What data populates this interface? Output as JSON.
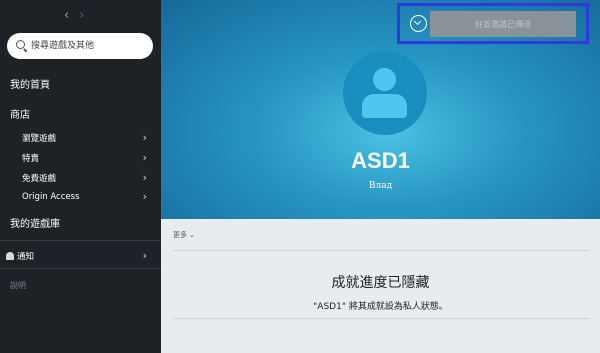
{
  "sidebar": {
    "nav_back": "‹",
    "nav_forward": "›",
    "search": {
      "placeholder": "搜尋遊戲及其他"
    },
    "home": "我的首頁",
    "store": "商店",
    "store_items": [
      {
        "label": "瀏覽遊戲"
      },
      {
        "label": "特賣"
      },
      {
        "label": "免費遊戲"
      },
      {
        "label": "Origin Access"
      }
    ],
    "library": "我的遊戲庫",
    "notifications": "通知",
    "help": "說明"
  },
  "profile": {
    "invite_button": "好友邀請已傳送",
    "username": "ASD1",
    "real_name": "Влад",
    "more": "更多"
  },
  "achievements": {
    "title": "成就進度已隱藏",
    "description": "\"ASD1\" 將其成就設為私人狀態。"
  },
  "colors": {
    "sidebar_bg": "#1e2227",
    "hero_accent": "#2796c3",
    "highlight_border": "#2d3ae0"
  }
}
